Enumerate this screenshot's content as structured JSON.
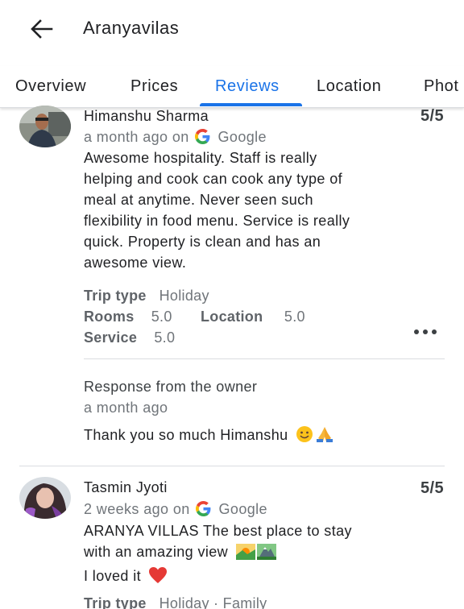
{
  "header": {
    "title": "Aranyavilas"
  },
  "tabs": [
    {
      "label": "Overview"
    },
    {
      "label": "Prices"
    },
    {
      "label": "Reviews"
    },
    {
      "label": "Location"
    },
    {
      "label": "Phot"
    }
  ],
  "colors": {
    "accent": "#1a73e8",
    "heart": "#e53935"
  },
  "reviews": [
    {
      "author": "Himanshu Sharma",
      "score": "5/5",
      "time": "a month ago on",
      "source": "Google",
      "text_lines": [
        "Awesome hospitality. Staff is really",
        "helping and cook can cook any type of",
        "meal at anytime. Never seen such",
        "flexibility in food menu. Service is really",
        "quick. Property is clean and has an",
        "awesome view."
      ],
      "trip_type_label": "Trip type",
      "trip_type_value": "Holiday",
      "rooms_label": "Rooms",
      "rooms_value": "5.0",
      "location_label": "Location",
      "location_value": "5.0",
      "service_label": "Service",
      "service_value": "5.0",
      "response": {
        "label": "Response from the owner",
        "time": "a month ago",
        "text": "Thank you so much Himanshu"
      }
    },
    {
      "author": "Tasmin Jyoti",
      "score": "5/5",
      "time": "2 weeks ago on",
      "source": "Google",
      "text_lines": [
        "ARANYA VILLAS The best place to stay",
        "with an amazing view",
        "I loved it"
      ],
      "trip_type_label": "Trip type",
      "trip_type_value": "Holiday · Family"
    }
  ]
}
